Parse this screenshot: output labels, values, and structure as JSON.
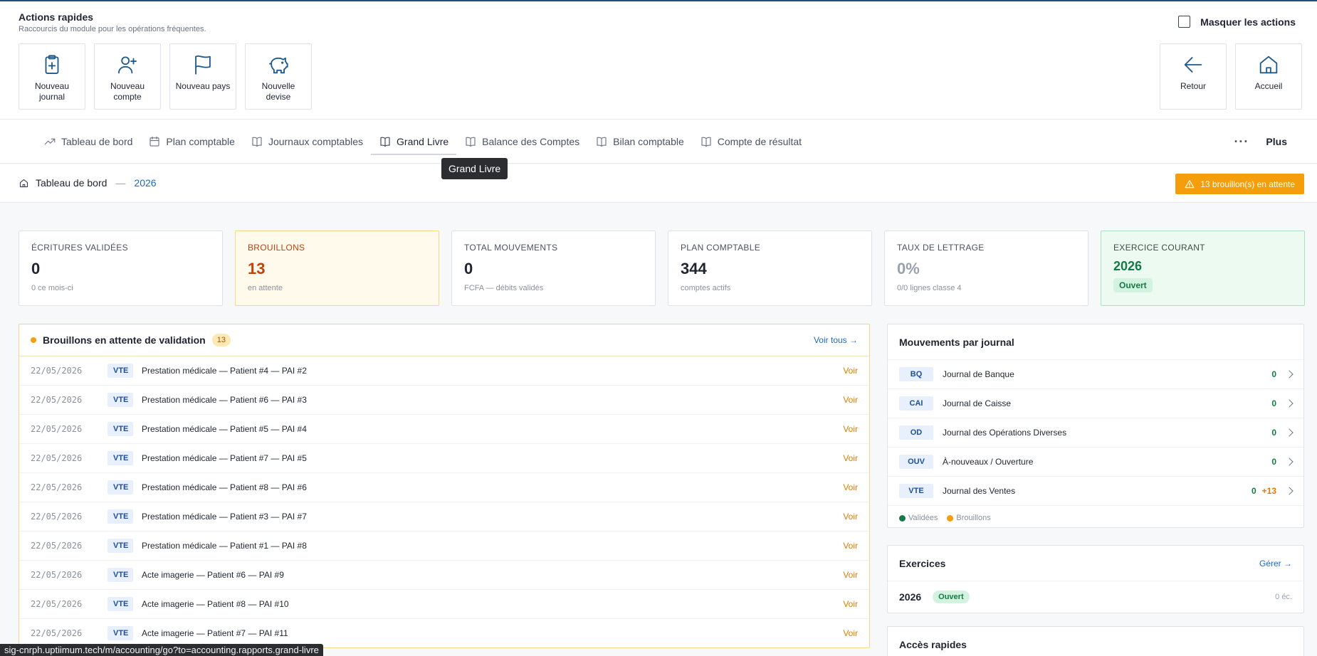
{
  "quick_actions": {
    "title": "Actions rapides",
    "subtitle": "Raccourcis du module pour les opérations fréquentes.",
    "hide_label": "Masquer les actions",
    "tiles": [
      {
        "label": "Nouveau journal",
        "icon": "clipboard-plus-icon"
      },
      {
        "label": "Nouveau compte",
        "icon": "user-plus-icon"
      },
      {
        "label": "Nouveau pays",
        "icon": "flag-icon"
      },
      {
        "label": "Nouvelle devise",
        "icon": "piggy-bank-icon"
      }
    ],
    "right_tiles": [
      {
        "label": "Retour",
        "icon": "arrow-left-icon"
      },
      {
        "label": "Accueil",
        "icon": "home-icon"
      }
    ]
  },
  "nav": {
    "items": [
      {
        "label": "Tableau de bord",
        "icon": "trend-icon"
      },
      {
        "label": "Plan comptable",
        "icon": "calendar-icon"
      },
      {
        "label": "Journaux comptables",
        "icon": "book-icon"
      },
      {
        "label": "Grand Livre",
        "icon": "book-icon"
      },
      {
        "label": "Balance des Comptes",
        "icon": "book-icon"
      },
      {
        "label": "Bilan comptable",
        "icon": "book-icon"
      },
      {
        "label": "Compte de résultat",
        "icon": "book-icon"
      }
    ],
    "active": "Grand Livre",
    "more_label": "Plus",
    "tooltip": "Grand Livre"
  },
  "breadcrumb": {
    "root": "Tableau de bord",
    "separator": "—",
    "year": "2026"
  },
  "draft_badge": "13 brouillon(s) en attente",
  "kpis": [
    {
      "label": "ÉCRITURES VALIDÉES",
      "value": "0",
      "sub": "0 ce mois-ci"
    },
    {
      "label": "BROUILLONS",
      "value": "13",
      "sub": "en attente"
    },
    {
      "label": "TOTAL MOUVEMENTS",
      "value": "0",
      "sub": "FCFA — débits validés"
    },
    {
      "label": "PLAN COMPTABLE",
      "value": "344",
      "sub": "comptes actifs"
    },
    {
      "label": "TAUX DE LETTRAGE",
      "value": "0%",
      "sub": "0/0 lignes classe 4"
    },
    {
      "label": "EXERCICE COURANT",
      "value": "2026",
      "sub": "Ouvert"
    }
  ],
  "drafts": {
    "title": "Brouillons en attente de validation",
    "count": "13",
    "see_all": "Voir tous →",
    "rows": [
      {
        "date": "22/05/2026",
        "journal": "VTE",
        "label": "Prestation médicale — Patient #4 — PAI #2",
        "action": "Voir"
      },
      {
        "date": "22/05/2026",
        "journal": "VTE",
        "label": "Prestation médicale — Patient #6 — PAI #3",
        "action": "Voir"
      },
      {
        "date": "22/05/2026",
        "journal": "VTE",
        "label": "Prestation médicale — Patient #5 — PAI #4",
        "action": "Voir"
      },
      {
        "date": "22/05/2026",
        "journal": "VTE",
        "label": "Prestation médicale — Patient #7 — PAI #5",
        "action": "Voir"
      },
      {
        "date": "22/05/2026",
        "journal": "VTE",
        "label": "Prestation médicale — Patient #8 — PAI #6",
        "action": "Voir"
      },
      {
        "date": "22/05/2026",
        "journal": "VTE",
        "label": "Prestation médicale — Patient #3 — PAI #7",
        "action": "Voir"
      },
      {
        "date": "22/05/2026",
        "journal": "VTE",
        "label": "Prestation médicale — Patient #1 — PAI #8",
        "action": "Voir"
      },
      {
        "date": "22/05/2026",
        "journal": "VTE",
        "label": "Acte imagerie — Patient #6 — PAI #9",
        "action": "Voir"
      },
      {
        "date": "22/05/2026",
        "journal": "VTE",
        "label": "Acte imagerie — Patient #8 — PAI #10",
        "action": "Voir"
      },
      {
        "date": "22/05/2026",
        "journal": "VTE",
        "label": "Acte imagerie — Patient #7 — PAI #11",
        "action": "Voir"
      }
    ]
  },
  "movements": {
    "title": "Mouvements par journal",
    "rows": [
      {
        "code": "BQ",
        "name": "Journal de Banque",
        "validated": "0",
        "drafts": ""
      },
      {
        "code": "CAI",
        "name": "Journal de Caisse",
        "validated": "0",
        "drafts": ""
      },
      {
        "code": "OD",
        "name": "Journal des Opérations Diverses",
        "validated": "0",
        "drafts": ""
      },
      {
        "code": "OUV",
        "name": "À-nouveaux / Ouverture",
        "validated": "0",
        "drafts": ""
      },
      {
        "code": "VTE",
        "name": "Journal des Ventes",
        "validated": "0",
        "drafts": "+13"
      }
    ],
    "legend": {
      "validated": "Validées",
      "drafts": "Brouillons"
    }
  },
  "exercises": {
    "title": "Exercices",
    "manage": "Gérer →",
    "rows": [
      {
        "year": "2026",
        "status": "Ouvert",
        "count": "0 éc."
      }
    ]
  },
  "quick_access": {
    "title": "Accès rapides"
  },
  "colors": {
    "accent": "#1f66c7",
    "draft": "#f59e0b",
    "validated": "#157a45"
  },
  "status_url": "sig-cnrph.uptiimum.tech/m/accounting/go?to=accounting.rapports.grand-livre"
}
